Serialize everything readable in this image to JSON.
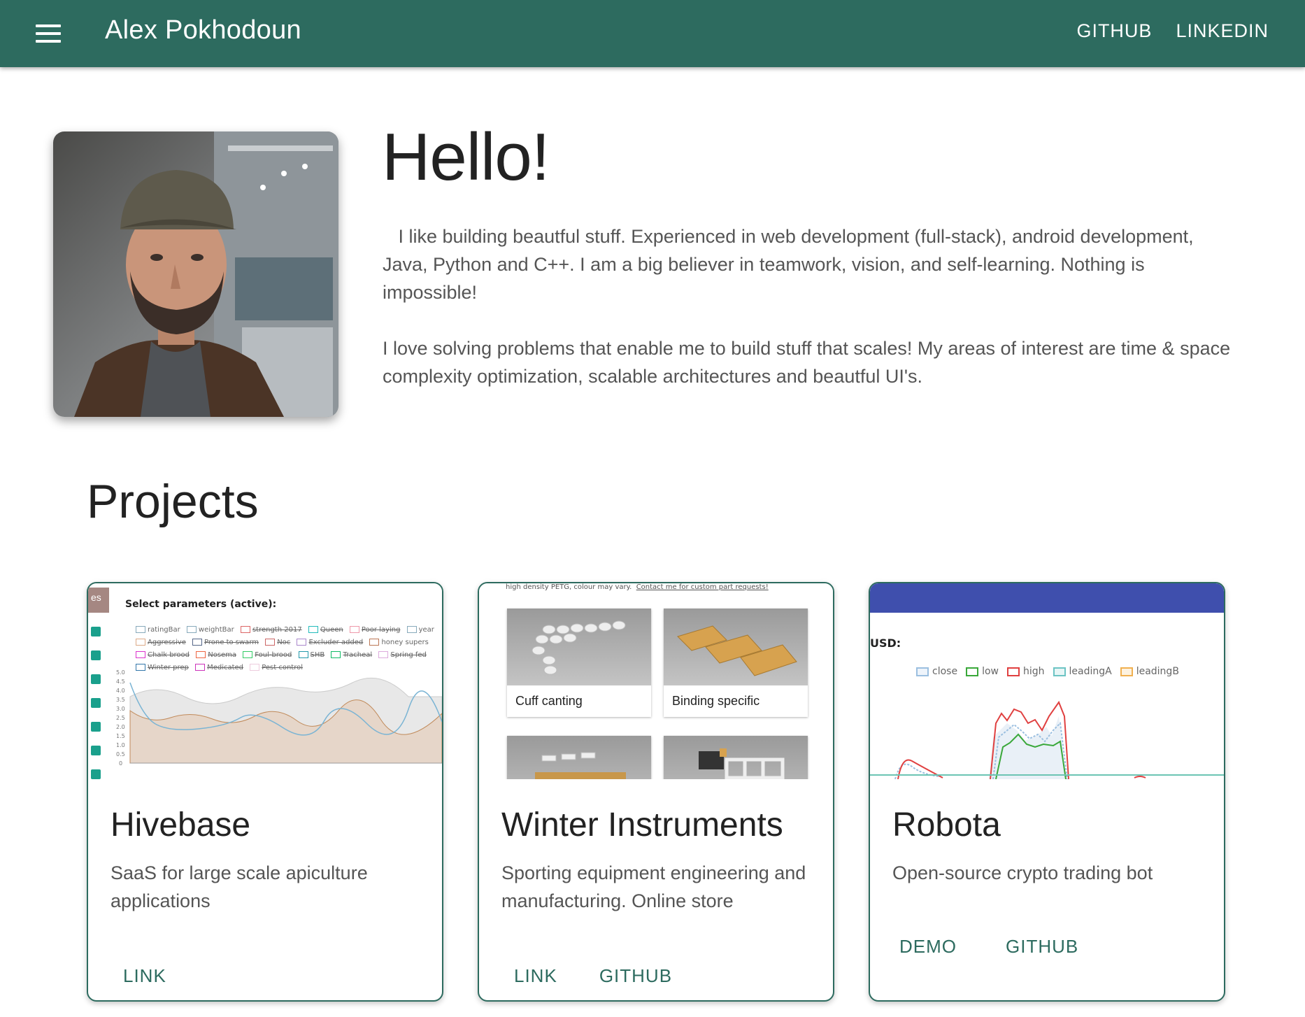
{
  "appbar": {
    "title": "Alex Pokhodoun",
    "nav": [
      "GITHUB",
      "LINKEDIN"
    ],
    "color": "#2d6b5f"
  },
  "hero": {
    "heading": "Hello!",
    "paragraphs": [
      "   I like building beautful stuff. Experienced in web development (full-stack), android development, Java, Python and C++. I am a big believer in teamwork, vision, and self-learning. Nothing is impossible!",
      "I love solving problems that enable me to build stuff that scales! My areas of interest are time & space complexity optimization, scalable architectures and beautful UI's."
    ]
  },
  "projects": {
    "heading": "Projects",
    "cards": [
      {
        "title": "Hivebase",
        "description": "SaaS for large scale apiculture applications",
        "actions": [
          "LINK"
        ],
        "preview": {
          "tab": "es",
          "heading": "Select parameters (active):",
          "legend": [
            "ratingBar",
            "weightBar",
            "strength 2017",
            "Queen",
            "Poor laying",
            "year",
            "Aggressive",
            "Prone to swarm",
            "Noc",
            "Excluder added",
            "honey supers",
            "Chalk brood",
            "Nosema",
            "Foul-brood",
            "SHB",
            "Tracheal",
            "Spring fed",
            "Winter prep",
            "Medicated",
            "Pest control"
          ],
          "yticks": [
            "5.0",
            "4.5",
            "4.0",
            "3.5",
            "3.0",
            "2.5",
            "2.0",
            "1.5",
            "1.0",
            "0.5",
            "0"
          ]
        }
      },
      {
        "title": "Winter Instruments",
        "description": "Sporting equipment engineering and manufacturing. Online store",
        "actions": [
          "LINK",
          "GITHUB"
        ],
        "preview": {
          "note": "high density PETG, colour may vary.",
          "note_link": "Contact me for custom part requests!",
          "tiles": [
            "Cuff canting",
            "Binding specific"
          ]
        }
      },
      {
        "title": "Robota",
        "description": "Open-source crypto trading bot",
        "actions": [
          "DEMO",
          "GITHUB"
        ],
        "preview": {
          "label": "USD:",
          "legend": [
            "close",
            "low",
            "high",
            "leadingA",
            "leadingB"
          ]
        }
      }
    ]
  }
}
